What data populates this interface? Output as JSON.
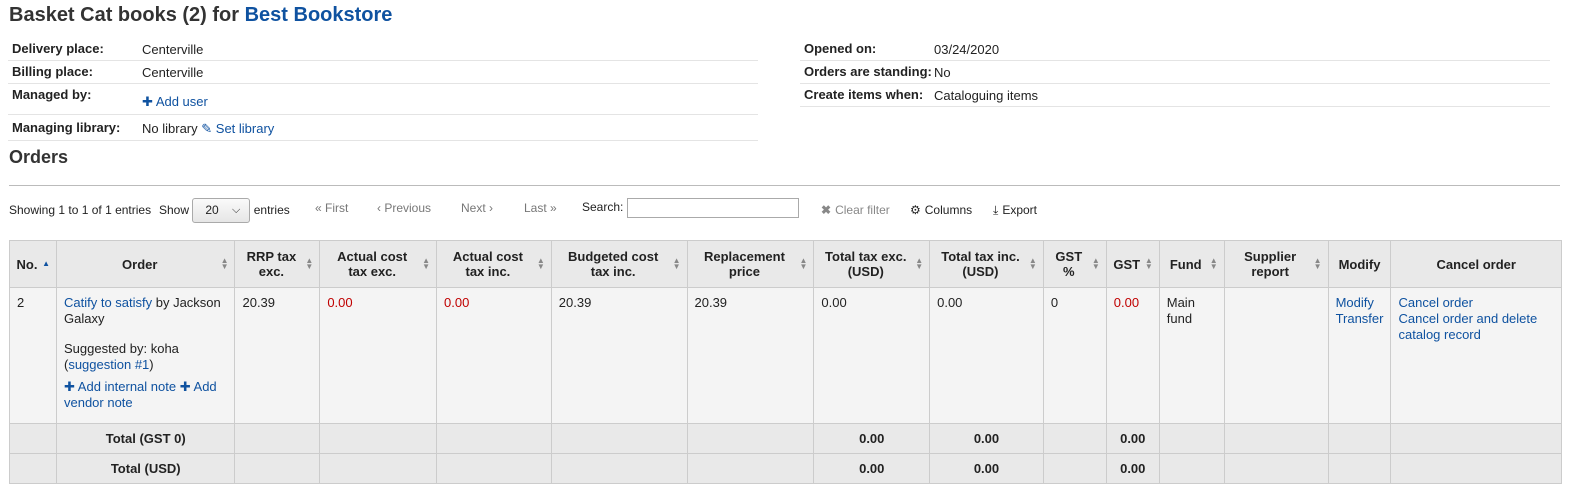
{
  "header": {
    "title_prefix": "Basket Cat books (2) for ",
    "vendor": "Best Bookstore"
  },
  "basket_info_left": [
    {
      "label": "Delivery place:",
      "value": "Centerville"
    },
    {
      "label": "Billing place:",
      "value": "Centerville"
    },
    {
      "label": "Managed by:",
      "value": ""
    },
    {
      "label": "Managing library:",
      "value": "No library"
    }
  ],
  "basket_actions": {
    "add_user": "Add user",
    "set_library": "Set library"
  },
  "basket_info_right": [
    {
      "label": "Opened on:",
      "value": "03/24/2020"
    },
    {
      "label": "Orders are standing:",
      "value": "No"
    },
    {
      "label": "Create items when:",
      "value": "Cataloguing items"
    }
  ],
  "orders": {
    "title": "Orders",
    "showing": "Showing 1 to 1 of 1 entries",
    "show_label": "Show",
    "page_size": "20",
    "entries_label": "entries",
    "pager": {
      "first": "First",
      "previous": "Previous",
      "next": "Next",
      "last": "Last"
    },
    "search_label": "Search:",
    "search_value": "",
    "clear_filter": "Clear filter",
    "columns_btn": "Columns",
    "export_btn": "Export"
  },
  "table": {
    "headers": {
      "no": "No.",
      "order": "Order",
      "rrp": "RRP tax exc.",
      "actual_exc": "Actual cost tax exc.",
      "actual_inc": "Actual cost tax inc.",
      "budgeted": "Budgeted cost tax inc.",
      "replacement": "Replacement price",
      "total_exc": "Total tax exc. (USD)",
      "total_inc": "Total tax inc. (USD)",
      "gst_pct": "GST %",
      "gst": "GST",
      "fund": "Fund",
      "supplier_report": "Supplier report",
      "modify": "Modify",
      "cancel": "Cancel order"
    },
    "row": {
      "no": "2",
      "title": "Catify to satisfy",
      "by": " by Jackson Galaxy",
      "suggested_by": "Suggested by: koha",
      "suggestion_open": "(",
      "suggestion_link": "suggestion #1",
      "suggestion_close": ")",
      "add_internal_note": "Add internal note",
      "add_vendor_note": "Add vendor note",
      "rrp": "20.39",
      "actual_exc": "0.00",
      "actual_inc": "0.00",
      "budgeted": "20.39",
      "replacement": "20.39",
      "total_exc": "0.00",
      "total_inc": "0.00",
      "gst_pct": "0",
      "gst": "0.00",
      "fund": "Main fund",
      "supplier_report": "",
      "modify": "Modify",
      "transfer": "Transfer",
      "cancel_order": "Cancel order",
      "cancel_delete": "Cancel order and delete catalog record"
    },
    "footer": [
      {
        "label": "Total (GST 0)",
        "total_exc": "0.00",
        "total_inc": "0.00",
        "gst": "0.00"
      },
      {
        "label": "Total (USD)",
        "total_exc": "0.00",
        "total_inc": "0.00",
        "gst": "0.00"
      }
    ]
  },
  "colors": {
    "link": "#0f52a0",
    "negative": "#c00000",
    "header_bg": "#e9e9e9"
  }
}
